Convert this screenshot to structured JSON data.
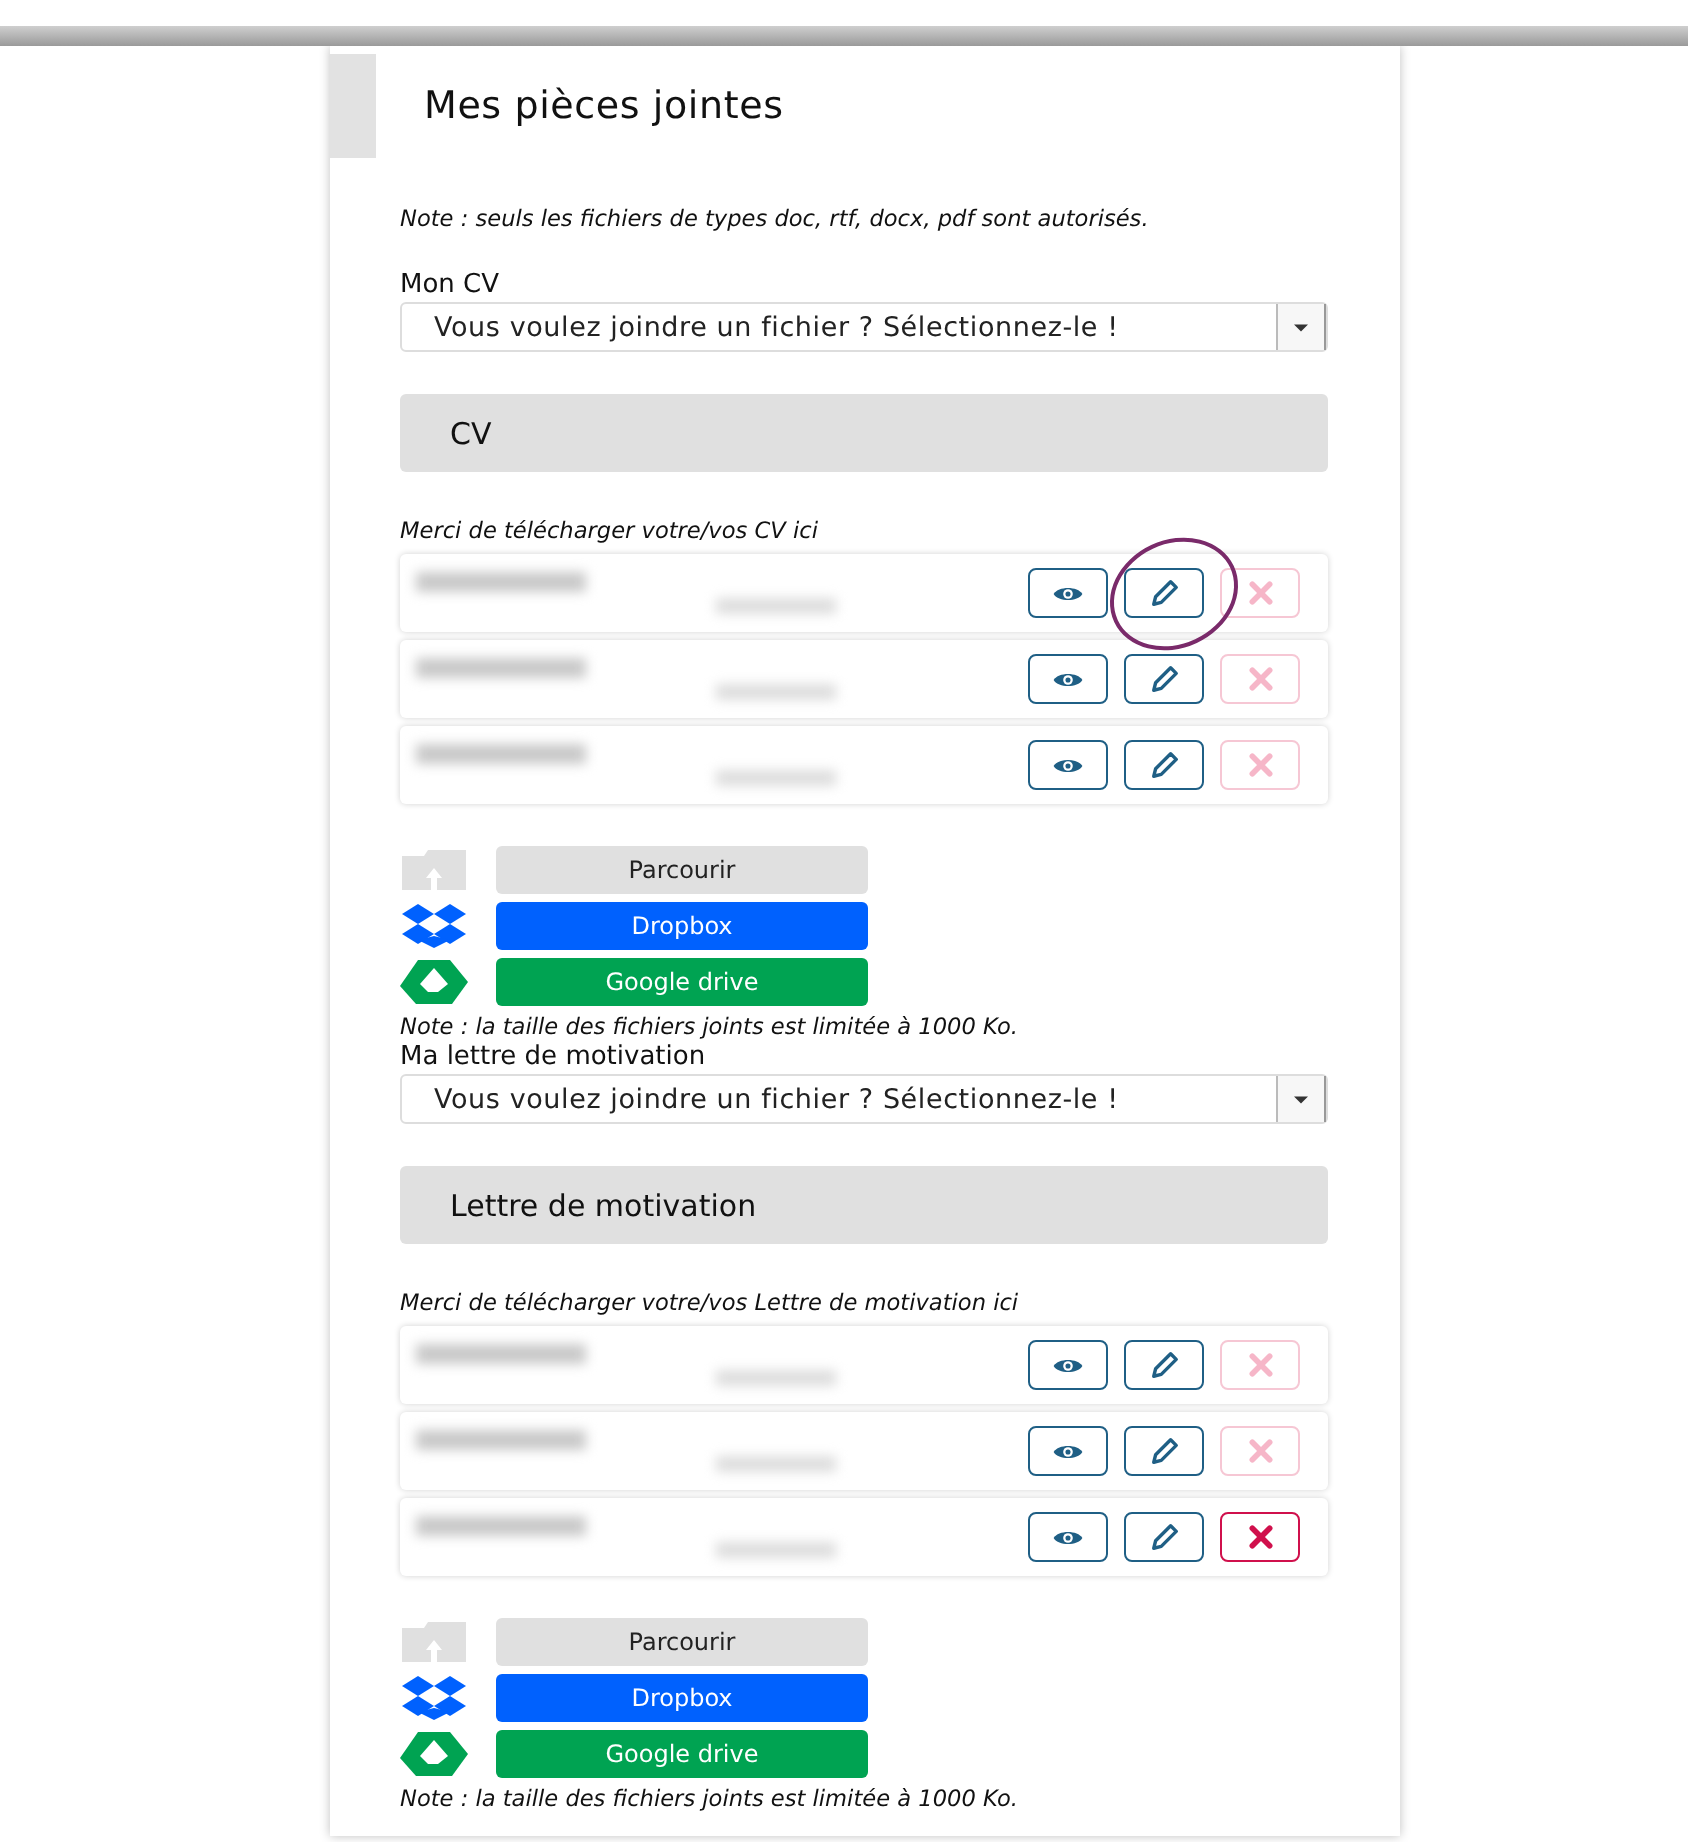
{
  "title": "Mes pièces jointes",
  "top_note": "Note : seuls les fichiers de types doc, rtf, docx, pdf sont autorisés.",
  "sections": [
    {
      "label": "Mon CV",
      "select_placeholder": "Vous voulez joindre un fichier ? Sélectionnez-le !",
      "header": "CV",
      "instructions": "Merci de télécharger votre/vos CV ici",
      "files": [
        {
          "delete_disabled": true,
          "annotated": true
        },
        {
          "delete_disabled": true,
          "annotated": false
        },
        {
          "delete_disabled": true,
          "annotated": false
        }
      ],
      "uploads": [
        {
          "kind": "browse",
          "label": "Parcourir"
        },
        {
          "kind": "dropbox",
          "label": "Dropbox"
        },
        {
          "kind": "drive",
          "label": "Google drive"
        }
      ],
      "note": "Note : la taille des fichiers joints est limitée à 1000 Ko."
    },
    {
      "label": "Ma lettre de motivation",
      "select_placeholder": "Vous voulez joindre un fichier ? Sélectionnez-le !",
      "header": "Lettre de motivation",
      "instructions": "Merci de télécharger votre/vos Lettre de motivation ici",
      "files": [
        {
          "delete_disabled": true,
          "annotated": false
        },
        {
          "delete_disabled": true,
          "annotated": false
        },
        {
          "delete_disabled": false,
          "annotated": false
        }
      ],
      "uploads": [
        {
          "kind": "browse",
          "label": "Parcourir"
        },
        {
          "kind": "dropbox",
          "label": "Dropbox"
        },
        {
          "kind": "drive",
          "label": "Google drive"
        }
      ],
      "note": "Note : la taille des fichiers joints est limitée à 1000 Ko."
    }
  ]
}
